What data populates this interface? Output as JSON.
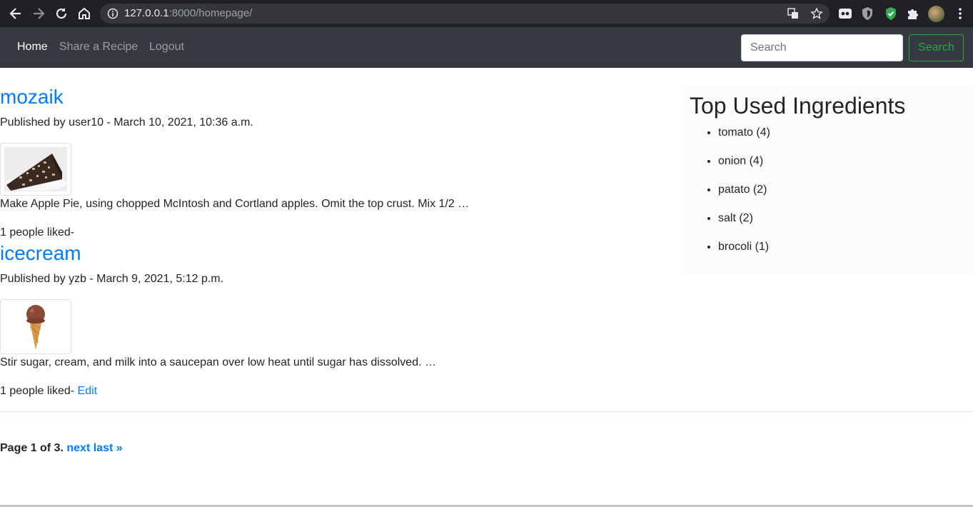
{
  "browser": {
    "url_host": "127.0.0.1",
    "url_path": ":8000/homepage/"
  },
  "nav": {
    "items": [
      {
        "label": "Home",
        "active": true
      },
      {
        "label": "Share a Recipe",
        "active": false
      },
      {
        "label": "Logout",
        "active": false
      }
    ],
    "search_placeholder": "Search",
    "search_button": "Search"
  },
  "posts": [
    {
      "title": "mozaik",
      "meta": "Published by user10 - March 10, 2021, 10:36 a.m.",
      "image": "cake-slice",
      "excerpt": "Make Apple Pie, using chopped McIntosh and Cortland apples. Omit the top crust. Mix 1/2 …",
      "likes": "1 people liked-",
      "edit": ""
    },
    {
      "title": "icecream",
      "meta": "Published by yzb - March 9, 2021, 5:12 p.m.",
      "image": "ice-cream-cone",
      "excerpt": "Stir sugar, cream, and milk into a saucepan over low heat until sugar has dissolved. …",
      "likes": "1 people liked-",
      "edit": "Edit"
    }
  ],
  "sidebar": {
    "title": "Top Used Ingredients",
    "items": [
      "tomato (4)",
      "onion (4)",
      "patato (2)",
      "salt (2)",
      "brocoli (1)"
    ]
  },
  "pagination": {
    "status": "Page 1 of 3.",
    "next": "next",
    "last": "last »"
  },
  "colors": {
    "navbar": "#343a40",
    "link": "#007bff",
    "success": "#28a745"
  }
}
